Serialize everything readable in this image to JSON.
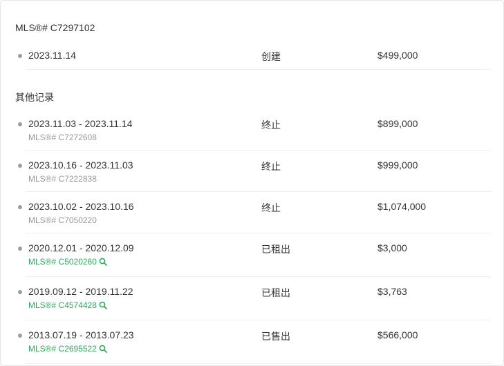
{
  "current": {
    "title": "MLS®# C7297102",
    "record": {
      "date": "2023.11.14",
      "status": "创建",
      "price": "$499,000"
    }
  },
  "other": {
    "title": "其他记录",
    "records": [
      {
        "date": "2023.11.03 - 2023.11.14",
        "mls": "MLS®# C7272608",
        "status": "终止",
        "price": "$899,000",
        "link": false
      },
      {
        "date": "2023.10.16 - 2023.11.03",
        "mls": "MLS®# C7222838",
        "status": "终止",
        "price": "$999,000",
        "link": false
      },
      {
        "date": "2023.10.02 - 2023.10.16",
        "mls": "MLS®# C7050220",
        "status": "终止",
        "price": "$1,074,000",
        "link": false
      },
      {
        "date": "2020.12.01 - 2020.12.09",
        "mls": "MLS®# C5020260",
        "status": "已租出",
        "price": "$3,000",
        "link": true
      },
      {
        "date": "2019.09.12 - 2019.11.22",
        "mls": "MLS®# C4574428",
        "status": "已租出",
        "price": "$3,763",
        "link": true
      },
      {
        "date": "2013.07.19 - 2013.07.23",
        "mls": "MLS®# C2695522",
        "status": "已售出",
        "price": "$566,000",
        "link": true
      }
    ]
  },
  "colors": {
    "link": "#2eaa5c",
    "muted": "#999999",
    "text": "#333333",
    "bullet": "#9e9e9e"
  },
  "icons": {
    "link_icon": "search-icon"
  }
}
